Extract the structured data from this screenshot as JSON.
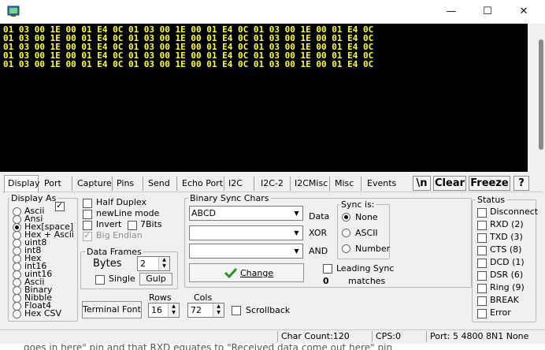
{
  "window": {
    "minimize": "—",
    "maximize": "☐",
    "close": "✕"
  },
  "terminal": {
    "lines": [
      "01 03 00 1E 00 01 E4 0C 01 03 00 1E 00 01 E4 0C 01 03 00 1E 00 01 E4 0C",
      "01 03 00 1E 00 01 E4 0C 01 03 00 1E 00 01 E4 0C 01 03 00 1E 00 01 E4 0C",
      "01 03 00 1E 00 01 E4 0C 01 03 00 1E 00 01 E4 0C 01 03 00 1E 00 01 E4 0C",
      "01 03 00 1E 00 01 E4 0C 01 03 00 1E 00 01 E4 0C 01 03 00 1E 00 01 E4 0C",
      "01 03 00 1E 00 01 E4 0C 01 03 00 1E 00 01 E4 0C 01 03 00 1E 00 01 E4 0C"
    ],
    "text_color": "#ffff3c",
    "background": "#000000"
  },
  "tabs": [
    "Display",
    "Port",
    "Capture",
    "Pins",
    "Send",
    "Echo Port",
    "I2C",
    "I2C-2",
    "I2CMisc",
    "Misc",
    "Events"
  ],
  "toolbar": {
    "newline_label": "\\n",
    "clear_label": "Clear",
    "freeze_label": "Freeze",
    "help_label": "?"
  },
  "display_as": {
    "title": "Display As",
    "options": [
      "Ascii",
      "Ansi",
      "Hex[space]",
      "Hex + Ascii",
      "uint8",
      "int8",
      "Hex",
      "int16",
      "uint16",
      "Ascii",
      "Binary",
      "Nibble",
      "Float4",
      "Hex CSV"
    ],
    "selected": "Hex[space]"
  },
  "options": {
    "half_duplex": "Half Duplex",
    "newline_mode": "newLine mode",
    "invert": "Invert",
    "sevenbits": "7Bits",
    "big_endian": "Big Endian"
  },
  "data_frames": {
    "title": "Data Frames",
    "bytes_label": "Bytes",
    "bytes_value": "2",
    "single_label": "Single",
    "gulp_label": "Gulp"
  },
  "binary_sync": {
    "title": "Binary Sync Chars",
    "data_value": "ABCD",
    "data_label": "Data",
    "xor_label": "XOR",
    "and_label": "AND",
    "change_label": "Change",
    "leading_sync": "Leading Sync",
    "matches_count": "0",
    "matches_label": "matches"
  },
  "sync_is": {
    "title": "Sync is:",
    "options": [
      "None",
      "ASCII",
      "Number"
    ],
    "selected": "None"
  },
  "bottom": {
    "terminal_font": "Terminal Font",
    "rows_label": "Rows",
    "rows_value": "16",
    "cols_label": "Cols",
    "cols_value": "72",
    "scrollback": "Scrollback"
  },
  "status_pins": {
    "title": "Status",
    "items": [
      "Disconnect",
      "RXD (2)",
      "TXD (3)",
      "CTS (8)",
      "DCD (1)",
      "DSR (6)",
      "Ring (9)",
      "BREAK",
      "Error"
    ]
  },
  "statusbar": {
    "char_count": "Char Count:120",
    "cps": "CPS:0",
    "port": "Port: 5  4800 8N1 None"
  },
  "background_text": "goes in here\" pin and that RXD equates to \"Received data come out here\" pin"
}
